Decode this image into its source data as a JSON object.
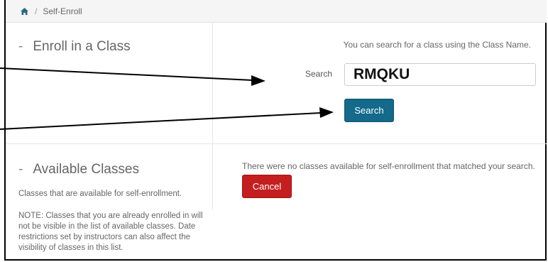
{
  "breadcrumb": {
    "current": "Self-Enroll",
    "separator": "/"
  },
  "enroll_section": {
    "title": "Enroll in a Class",
    "hint": "You can search for a class using the Class Name.",
    "search_label": "Search",
    "search_value": "RMQKU",
    "search_button": "Search"
  },
  "available_section": {
    "title": "Available Classes",
    "description": "Classes that are available for self-enrollment.",
    "note": "NOTE: Classes that you are already enrolled in will not be visible in the list of available classes. Date restrictions set by instructors can also affect the visibility of classes in this list.",
    "no_results": "There were no classes available for self-enrollment that matched your search.",
    "cancel_button": "Cancel"
  },
  "colors": {
    "primary": "#136a8a",
    "danger": "#c41e1e"
  },
  "icons": {
    "home": "home-icon"
  }
}
